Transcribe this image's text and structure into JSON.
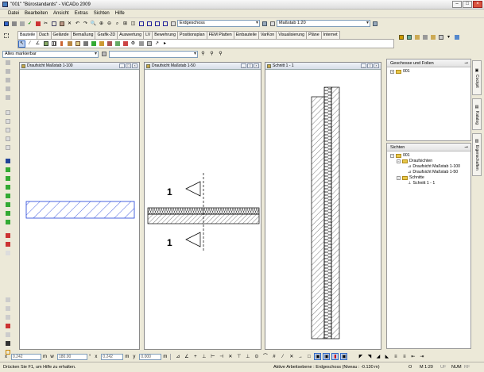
{
  "window": {
    "title": "\"001\" \"Bürostandards\" - ViCADo 2009"
  },
  "menu": [
    "Datei",
    "Bearbeiten",
    "Ansicht",
    "Extras",
    "Sichten",
    "Hilfe"
  ],
  "toolbar": {
    "floor_select": "Erdgeschoss",
    "scale_select": "Maßstab 1:20"
  },
  "tabs": [
    "Bauteile",
    "Dach",
    "Gelände",
    "Bemaßung",
    "Grafik-2D",
    "Auswertung",
    "LV",
    "Bewehrung",
    "Positionsplan",
    "FEM Platten",
    "Einbauteile",
    "VarKon",
    "Visualisierung",
    "Pläne",
    "Internet"
  ],
  "filter": {
    "value": "Alles markierbar"
  },
  "views": [
    {
      "title": "Draufsicht Maßstab 1-100"
    },
    {
      "title": "Draufsicht Maßstab 1-50",
      "mark_top": "1",
      "mark_bottom": "1"
    },
    {
      "title": "Schnitt 1 - 1"
    }
  ],
  "panel_floors": {
    "title": "Geschosse und Folien",
    "root": "001"
  },
  "panel_views": {
    "title": "Sichten",
    "root": "001",
    "folder1": "Draufsichten",
    "item1": "Draufsicht Maßstab 1-100",
    "item2": "Draufsicht Maßstab 1-50",
    "folder2": "Schnitte",
    "item3": "Schnitt 1 - 1"
  },
  "side_tabs": [
    "Cockpit",
    "Katalog",
    "Eigenschaften"
  ],
  "coords": {
    "x": "0.242",
    "x_unit": "m",
    "w": "180.00",
    "w_unit": "°",
    "dx": "0.242",
    "dx_unit": "m",
    "y": "0.000",
    "y_unit": "m"
  },
  "status": {
    "hint": "Drücken Sie F1, um Hilfe zu erhalten.",
    "level": "Aktive Arbeitsebene : Erdgeschoss (Niveau : -0.130 m)",
    "o": "O",
    "scale": "M 1:20",
    "uf": "UF",
    "num": "NUM",
    "rf": "RF"
  },
  "colors": {
    "hatch_blue": "#1f3fd8",
    "titlebar_accent": "#4a7fc1"
  }
}
